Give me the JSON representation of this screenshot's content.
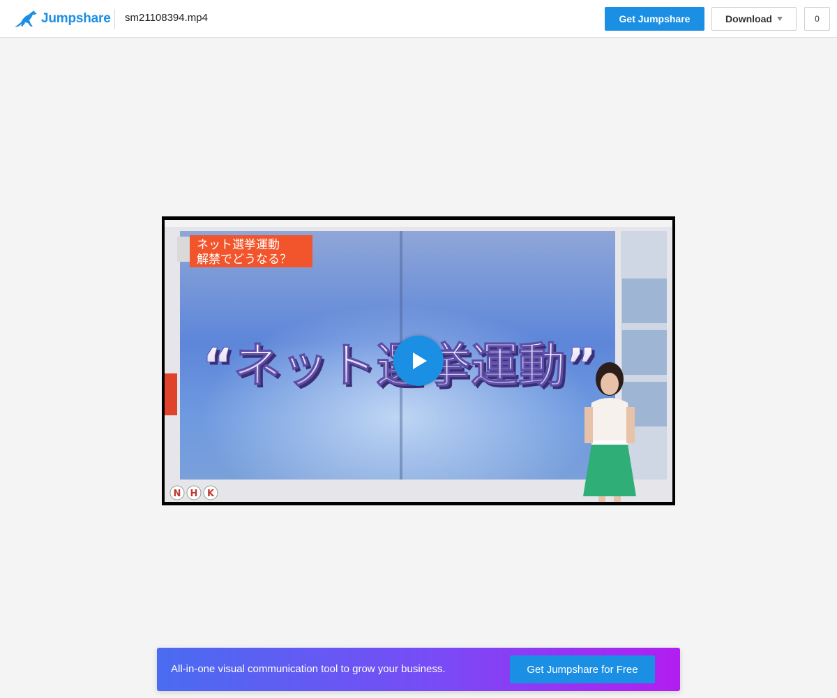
{
  "header": {
    "brand_name": "Jumpshare",
    "brand_icon": "kangaroo-logo-icon",
    "file_name": "sm21108394.mp4",
    "get_button_label": "Get Jumpshare",
    "download_button_label": "Download",
    "view_count": "0"
  },
  "video": {
    "play_icon": "play-icon",
    "overlay_caption_line1": "ネット選挙運動",
    "overlay_caption_line2": "解禁でどうなる？",
    "main_graphic_text": "“ネット選挙運動”",
    "channel_logo_letters": [
      "N",
      "H",
      "K"
    ]
  },
  "promo": {
    "text": "All-in-one visual communication tool to grow your business.",
    "button_label": "Get Jumpshare for Free"
  },
  "colors": {
    "brand_blue": "#1a8fe3",
    "page_background": "#f4f4f4",
    "promo_gradient_start": "#4a6cf0",
    "promo_gradient_end": "#b21ef0"
  }
}
